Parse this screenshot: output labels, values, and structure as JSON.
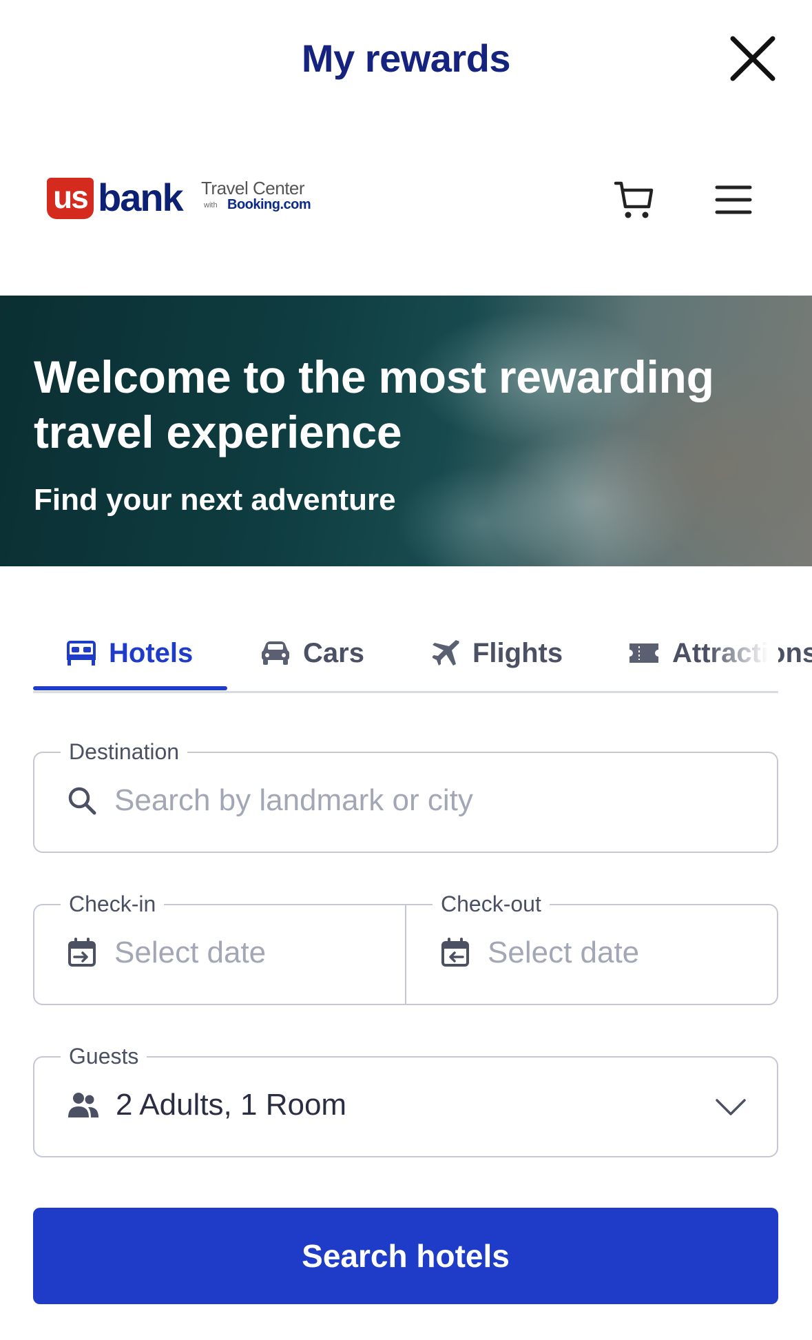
{
  "header": {
    "title": "My rewards",
    "close_icon": "close-icon"
  },
  "brand": {
    "logo_us": "us",
    "logo_bank": "bank",
    "logo_travel_center": "Travel Center",
    "logo_with": "with",
    "logo_booking": "Booking.com",
    "cart_icon": "cart-icon",
    "menu_icon": "hamburger-menu-icon"
  },
  "hero": {
    "headline": "Welcome to the most rewarding travel experience",
    "subheadline": "Find your next adventure"
  },
  "tabs": [
    {
      "label": "Hotels",
      "icon": "bed-icon",
      "active": true
    },
    {
      "label": "Cars",
      "icon": "car-icon",
      "active": false
    },
    {
      "label": "Flights",
      "icon": "plane-icon",
      "active": false
    },
    {
      "label": "Attractions",
      "icon": "ticket-icon",
      "active": false
    }
  ],
  "form": {
    "destination": {
      "label": "Destination",
      "placeholder": "Search by landmark or city",
      "icon": "search-icon"
    },
    "checkin": {
      "label": "Check-in",
      "placeholder": "Select date",
      "icon": "calendar-in-icon"
    },
    "checkout": {
      "label": "Check-out",
      "placeholder": "Select date",
      "icon": "calendar-out-icon"
    },
    "guests": {
      "label": "Guests",
      "value": "2 Adults, 1 Room",
      "icon": "people-icon",
      "dropdown_icon": "chevron-down-icon"
    },
    "submit_label": "Search hotels"
  },
  "colors": {
    "accent": "#1e3cc8",
    "title_navy": "#16237e",
    "brand_red": "#d52b1e"
  }
}
